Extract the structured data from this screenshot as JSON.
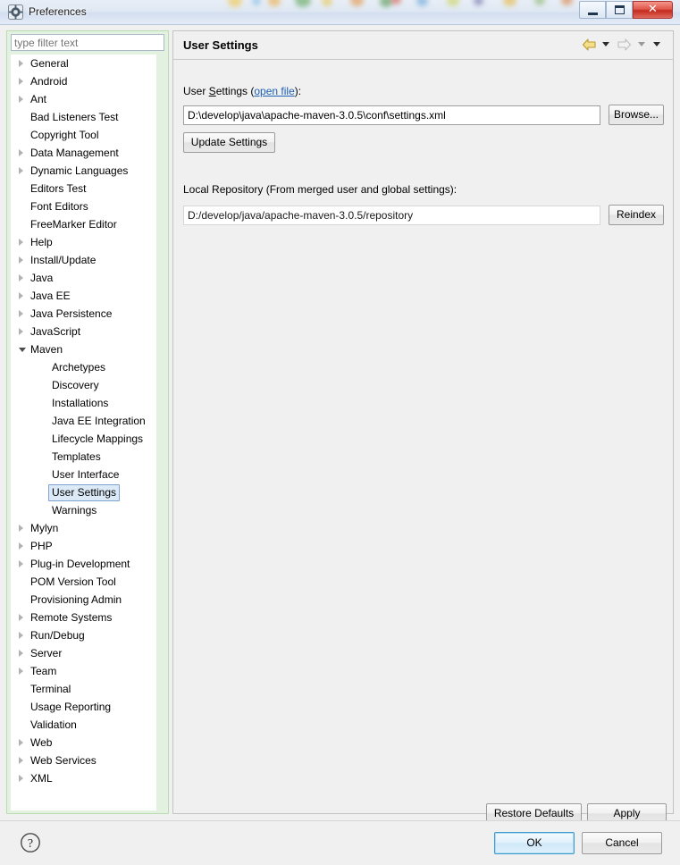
{
  "window": {
    "title": "Preferences",
    "icon": "preferences-gear-icon",
    "minimize_label": "Minimize",
    "maximize_label": "Maximize",
    "close_label": "Close"
  },
  "sidebar": {
    "filter": {
      "placeholder": "type filter text",
      "value": ""
    },
    "items": [
      {
        "label": "General",
        "depth": 0,
        "expandable": true,
        "expanded": false,
        "selected": false
      },
      {
        "label": "Android",
        "depth": 0,
        "expandable": true,
        "expanded": false,
        "selected": false
      },
      {
        "label": "Ant",
        "depth": 0,
        "expandable": true,
        "expanded": false,
        "selected": false
      },
      {
        "label": "Bad Listeners Test",
        "depth": 0,
        "expandable": false,
        "expanded": false,
        "selected": false
      },
      {
        "label": "Copyright Tool",
        "depth": 0,
        "expandable": false,
        "expanded": false,
        "selected": false
      },
      {
        "label": "Data Management",
        "depth": 0,
        "expandable": true,
        "expanded": false,
        "selected": false
      },
      {
        "label": "Dynamic Languages",
        "depth": 0,
        "expandable": true,
        "expanded": false,
        "selected": false
      },
      {
        "label": "Editors Test",
        "depth": 0,
        "expandable": false,
        "expanded": false,
        "selected": false
      },
      {
        "label": "Font Editors",
        "depth": 0,
        "expandable": false,
        "expanded": false,
        "selected": false
      },
      {
        "label": "FreeMarker Editor",
        "depth": 0,
        "expandable": false,
        "expanded": false,
        "selected": false
      },
      {
        "label": "Help",
        "depth": 0,
        "expandable": true,
        "expanded": false,
        "selected": false
      },
      {
        "label": "Install/Update",
        "depth": 0,
        "expandable": true,
        "expanded": false,
        "selected": false
      },
      {
        "label": "Java",
        "depth": 0,
        "expandable": true,
        "expanded": false,
        "selected": false
      },
      {
        "label": "Java EE",
        "depth": 0,
        "expandable": true,
        "expanded": false,
        "selected": false
      },
      {
        "label": "Java Persistence",
        "depth": 0,
        "expandable": true,
        "expanded": false,
        "selected": false
      },
      {
        "label": "JavaScript",
        "depth": 0,
        "expandable": true,
        "expanded": false,
        "selected": false
      },
      {
        "label": "Maven",
        "depth": 0,
        "expandable": true,
        "expanded": true,
        "selected": false
      },
      {
        "label": "Archetypes",
        "depth": 1,
        "expandable": false,
        "expanded": false,
        "selected": false
      },
      {
        "label": "Discovery",
        "depth": 1,
        "expandable": false,
        "expanded": false,
        "selected": false
      },
      {
        "label": "Installations",
        "depth": 1,
        "expandable": false,
        "expanded": false,
        "selected": false
      },
      {
        "label": "Java EE Integration",
        "depth": 1,
        "expandable": false,
        "expanded": false,
        "selected": false
      },
      {
        "label": "Lifecycle Mappings",
        "depth": 1,
        "expandable": false,
        "expanded": false,
        "selected": false
      },
      {
        "label": "Templates",
        "depth": 1,
        "expandable": false,
        "expanded": false,
        "selected": false
      },
      {
        "label": "User Interface",
        "depth": 1,
        "expandable": false,
        "expanded": false,
        "selected": false
      },
      {
        "label": "User Settings",
        "depth": 1,
        "expandable": false,
        "expanded": false,
        "selected": true
      },
      {
        "label": "Warnings",
        "depth": 1,
        "expandable": false,
        "expanded": false,
        "selected": false
      },
      {
        "label": "Mylyn",
        "depth": 0,
        "expandable": true,
        "expanded": false,
        "selected": false
      },
      {
        "label": "PHP",
        "depth": 0,
        "expandable": true,
        "expanded": false,
        "selected": false
      },
      {
        "label": "Plug-in Development",
        "depth": 0,
        "expandable": true,
        "expanded": false,
        "selected": false
      },
      {
        "label": "POM Version Tool",
        "depth": 0,
        "expandable": false,
        "expanded": false,
        "selected": false
      },
      {
        "label": "Provisioning Admin",
        "depth": 0,
        "expandable": false,
        "expanded": false,
        "selected": false
      },
      {
        "label": "Remote Systems",
        "depth": 0,
        "expandable": true,
        "expanded": false,
        "selected": false
      },
      {
        "label": "Run/Debug",
        "depth": 0,
        "expandable": true,
        "expanded": false,
        "selected": false
      },
      {
        "label": "Server",
        "depth": 0,
        "expandable": true,
        "expanded": false,
        "selected": false
      },
      {
        "label": "Team",
        "depth": 0,
        "expandable": true,
        "expanded": false,
        "selected": false
      },
      {
        "label": "Terminal",
        "depth": 0,
        "expandable": false,
        "expanded": false,
        "selected": false
      },
      {
        "label": "Usage Reporting",
        "depth": 0,
        "expandable": false,
        "expanded": false,
        "selected": false
      },
      {
        "label": "Validation",
        "depth": 0,
        "expandable": false,
        "expanded": false,
        "selected": false
      },
      {
        "label": "Web",
        "depth": 0,
        "expandable": true,
        "expanded": false,
        "selected": false
      },
      {
        "label": "Web Services",
        "depth": 0,
        "expandable": true,
        "expanded": false,
        "selected": false
      },
      {
        "label": "XML",
        "depth": 0,
        "expandable": true,
        "expanded": false,
        "selected": false
      }
    ]
  },
  "page": {
    "title": "User Settings",
    "nav": {
      "back_label": "Back",
      "back_menu_label": "Back history",
      "forward_label": "Forward",
      "forward_menu_label": "Forward history",
      "menu_label": "View menu"
    },
    "user_settings": {
      "label_prefix": "User ",
      "label_mnemonic": "S",
      "label_suffix": "ettings (",
      "open_file_link": "open file",
      "label_end": "):",
      "path_value": "D:\\develop\\java\\apache-maven-3.0.5\\conf\\settings.xml",
      "browse_label": "Browse...",
      "update_label": "Update Settings"
    },
    "local_repository": {
      "label": "Local Repository (From merged user and global settings):",
      "path_value": "D:/develop/java/apache-maven-3.0.5/repository",
      "reindex_label": "Reindex"
    },
    "restore_defaults_label": "Restore Defaults",
    "apply_label": "Apply"
  },
  "footer": {
    "help_label": "?",
    "ok_label": "OK",
    "cancel_label": "Cancel"
  },
  "colors": {
    "accent_selection": "#dce9f7",
    "selection_border": "#7da2ce",
    "sidebar_green": "#e3f2e0",
    "link": "#1a5fb4",
    "close_button_red": "#c32b1d",
    "focus_blue": "#3c9bd0"
  }
}
